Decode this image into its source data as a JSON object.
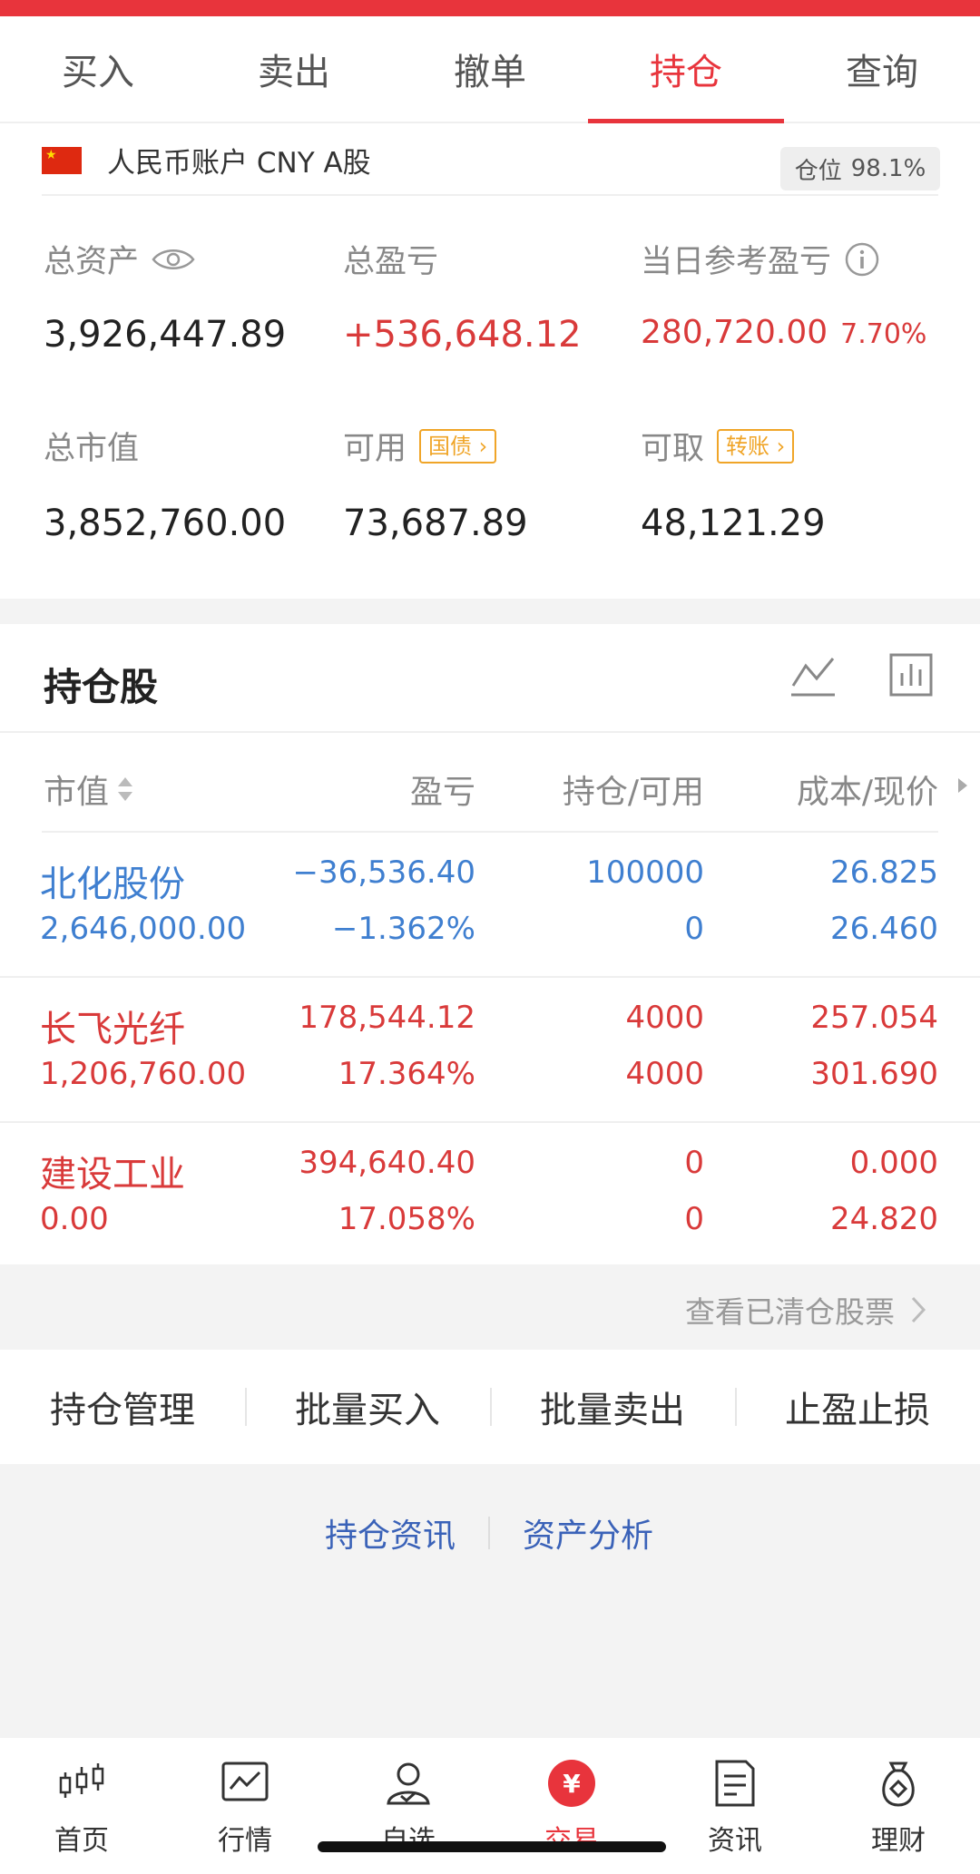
{
  "tabs": [
    {
      "label": "买入"
    },
    {
      "label": "卖出"
    },
    {
      "label": "撤单"
    },
    {
      "label": "持仓"
    },
    {
      "label": "查询"
    }
  ],
  "active_tab": "持仓",
  "account": {
    "name": "人民币账户 CNY A股",
    "position_label": "仓位",
    "position_value": "98.1%"
  },
  "summary": {
    "total_assets_label": "总资产",
    "total_assets": "3,926,447.89",
    "total_pnl_label": "总盈亏",
    "total_pnl": "+536,648.12",
    "daily_pnl_label": "当日参考盈亏",
    "daily_pnl": "280,720.00",
    "daily_pnl_pct": "7.70%",
    "market_value_label": "总市值",
    "market_value": "3,852,760.00",
    "available_label": "可用",
    "available_tag": "国债",
    "available": "73,687.89",
    "withdrawable_label": "可取",
    "withdrawable_tag": "转账",
    "withdrawable": "48,121.29"
  },
  "holdings": {
    "title": "持仓股",
    "columns": {
      "market_value": "市值",
      "pnl": "盈亏",
      "position": "持仓/可用",
      "cost_price": "成本/现价"
    },
    "rows": [
      {
        "name": "北化股份",
        "market_value": "2,646,000.00",
        "pnl": "−36,536.40",
        "pnl_pct": "−1.362%",
        "position": "100000",
        "available": "0",
        "cost": "26.825",
        "price": "26.460",
        "color": "#3f7fd0"
      },
      {
        "name": "长飞光纤",
        "market_value": "1,206,760.00",
        "pnl": "178,544.12",
        "pnl_pct": "17.364%",
        "position": "4000",
        "available": "4000",
        "cost": "257.054",
        "price": "301.690",
        "color": "#d93a3a"
      },
      {
        "name": "建设工业",
        "market_value": "0.00",
        "pnl": "394,640.40",
        "pnl_pct": "17.058%",
        "position": "0",
        "available": "0",
        "cost": "0.000",
        "price": "24.820",
        "color": "#d93a3a"
      }
    ]
  },
  "cleared_link": "查看已清仓股票",
  "actions": [
    {
      "label": "持仓管理"
    },
    {
      "label": "批量买入"
    },
    {
      "label": "批量卖出"
    },
    {
      "label": "止盈止损"
    }
  ],
  "links": {
    "holding_news": "持仓资讯",
    "asset_analysis": "资产分析"
  },
  "bottom_nav": [
    {
      "label": "首页",
      "icon": "candlestick-icon"
    },
    {
      "label": "行情",
      "icon": "chart-icon"
    },
    {
      "label": "自选",
      "icon": "person-icon"
    },
    {
      "label": "交易",
      "icon": "yuan-icon"
    },
    {
      "label": "资讯",
      "icon": "document-icon"
    },
    {
      "label": "理财",
      "icon": "money-bag-icon"
    }
  ],
  "colors": {
    "accent_red": "#e8343c",
    "loss_blue": "#3f7fd0",
    "gain_red": "#d93a3a",
    "tag_orange": "#f0a528",
    "link_blue": "#3a62b8"
  }
}
